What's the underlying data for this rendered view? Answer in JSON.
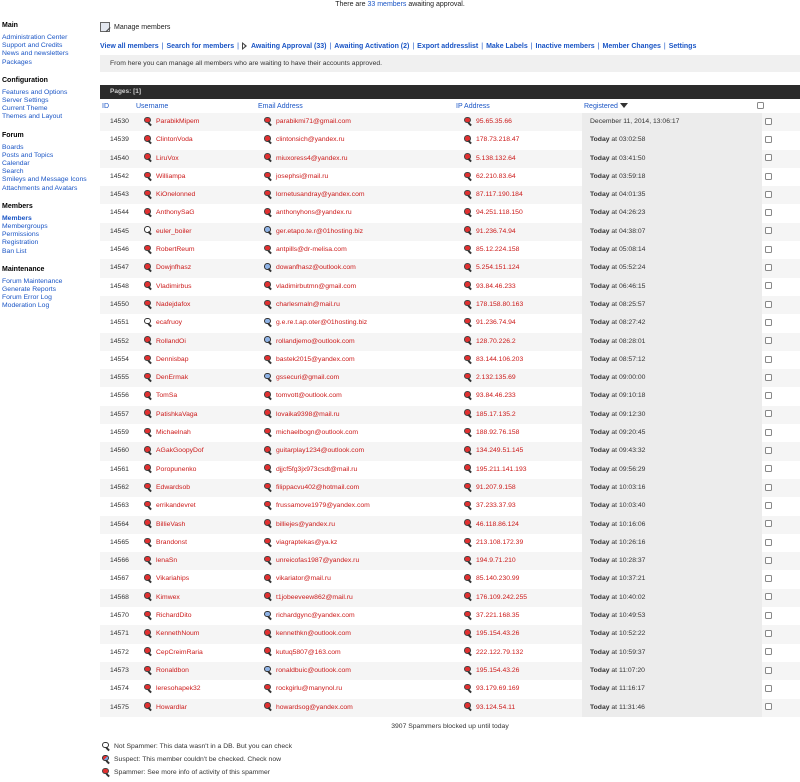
{
  "topbar": {
    "prefix": "There are",
    "link": "33 members",
    "suffix": "awaiting approval."
  },
  "sidebar": {
    "sections": [
      {
        "title": "Main",
        "items": [
          "Administration Center",
          "Support and Credits",
          "News and newsletters",
          "Packages"
        ]
      },
      {
        "title": "Configuration",
        "items": [
          "Features and Options",
          "Server Settings",
          "Current Theme",
          "Themes and Layout"
        ]
      },
      {
        "title": "Forum",
        "items": [
          "Boards",
          "Posts and Topics",
          "Calendar",
          "Search",
          "Smileys and Message Icons",
          "Attachments and Avatars"
        ]
      },
      {
        "title": "Members",
        "items": [
          "Members",
          "Membergroups",
          "Permissions",
          "Registration",
          "Ban List"
        ]
      },
      {
        "title": "Maintenance",
        "items": [
          "Forum Maintenance",
          "Generate Reports",
          "Forum Error Log",
          "Moderation Log"
        ]
      }
    ],
    "active_item": "Members"
  },
  "page_title": "Manage members",
  "tabs": [
    {
      "label": "View all members"
    },
    {
      "label": "Search for members"
    },
    {
      "label": "Awaiting Approval (33)"
    },
    {
      "label": "Awaiting Activation (2)"
    },
    {
      "label": "Export addresslist"
    },
    {
      "label": "Make Labels"
    },
    {
      "label": "Inactive members"
    },
    {
      "label": "Member Changes"
    },
    {
      "label": "Settings"
    }
  ],
  "description": "From here you can manage all members who are waiting to have their accounts approved.",
  "pages_label": "Pages: [1]",
  "columns": {
    "id": "ID",
    "username": "Username",
    "email": "Email Address",
    "ip": "IP Address",
    "registered": "Registered"
  },
  "members": [
    {
      "id": "14530",
      "username": "ParabikMipem",
      "email": "parabikmi71@gmail.com",
      "ip": "95.65.35.66",
      "reg_day": "December 11, 2014, 13:06:17",
      "reg_time": "",
      "ue": "red",
      "ee": "red",
      "ie": "red"
    },
    {
      "id": "14539",
      "username": "ClintonVoda",
      "email": "clintonsich@yandex.ru",
      "ip": "178.73.218.47",
      "reg_day": "Today",
      "reg_time": "at 03:02:58",
      "ue": "red",
      "ee": "red",
      "ie": "red"
    },
    {
      "id": "14540",
      "username": "LiruVox",
      "email": "miuxoress4@yandex.ru",
      "ip": "5.138.132.64",
      "reg_day": "Today",
      "reg_time": "at 03:41:50",
      "ue": "red",
      "ee": "red",
      "ie": "red"
    },
    {
      "id": "14542",
      "username": "Williampa",
      "email": "josephsi@mail.ru",
      "ip": "62.210.83.64",
      "reg_day": "Today",
      "reg_time": "at 03:59:18",
      "ue": "red",
      "ee": "red",
      "ie": "red"
    },
    {
      "id": "14543",
      "username": "KiOnelonned",
      "email": "lornetusandray@yandex.com",
      "ip": "87.117.190.184",
      "reg_day": "Today",
      "reg_time": "at 04:01:35",
      "ue": "red",
      "ee": "red",
      "ie": "red"
    },
    {
      "id": "14544",
      "username": "AnthonySaG",
      "email": "anthonyhons@yandex.ru",
      "ip": "94.251.118.150",
      "reg_day": "Today",
      "reg_time": "at 04:26:23",
      "ue": "red",
      "ee": "red",
      "ie": "red"
    },
    {
      "id": "14545",
      "username": "euler_boiler",
      "email": "ger.etapo.te.r@01hosting.biz",
      "ip": "91.236.74.94",
      "reg_day": "Today",
      "reg_time": "at 04:38:07",
      "ue": "white",
      "ee": "blue",
      "ie": "red"
    },
    {
      "id": "14546",
      "username": "RobertReum",
      "email": "antpills@dr-melisa.com",
      "ip": "85.12.224.158",
      "reg_day": "Today",
      "reg_time": "at 05:08:14",
      "ue": "red",
      "ee": "red",
      "ie": "red"
    },
    {
      "id": "14547",
      "username": "Dowjnfhasz",
      "email": "dowanfhasz@outlook.com",
      "ip": "5.254.151.124",
      "reg_day": "Today",
      "reg_time": "at 05:52:24",
      "ue": "red",
      "ee": "blue",
      "ie": "red"
    },
    {
      "id": "14548",
      "username": "Vladimirbus",
      "email": "vladimirbutmn@gmail.com",
      "ip": "93.84.46.233",
      "reg_day": "Today",
      "reg_time": "at 06:46:15",
      "ue": "red",
      "ee": "red",
      "ie": "red"
    },
    {
      "id": "14550",
      "username": "Nadejdafox",
      "email": "charlesmaln@mail.ru",
      "ip": "178.158.80.163",
      "reg_day": "Today",
      "reg_time": "at 08:25:57",
      "ue": "red",
      "ee": "red",
      "ie": "red"
    },
    {
      "id": "14551",
      "username": "ecafruoy",
      "email": "g.e.re.t.ap.oter@01hosting.biz",
      "ip": "91.236.74.94",
      "reg_day": "Today",
      "reg_time": "at 08:27:42",
      "ue": "white",
      "ee": "blue",
      "ie": "red"
    },
    {
      "id": "14552",
      "username": "RollandOi",
      "email": "rollandjemo@outlook.com",
      "ip": "128.70.226.2",
      "reg_day": "Today",
      "reg_time": "at 08:28:01",
      "ue": "red",
      "ee": "blue",
      "ie": "red"
    },
    {
      "id": "14554",
      "username": "Dennisbap",
      "email": "bastek2015@yandex.com",
      "ip": "83.144.106.203",
      "reg_day": "Today",
      "reg_time": "at 08:57:12",
      "ue": "red",
      "ee": "red",
      "ie": "red"
    },
    {
      "id": "14555",
      "username": "DenErmak",
      "email": "gssecuri@gmail.com",
      "ip": "2.132.135.69",
      "reg_day": "Today",
      "reg_time": "at 09:00:00",
      "ue": "red",
      "ee": "blue",
      "ie": "red"
    },
    {
      "id": "14556",
      "username": "TomSa",
      "email": "tomvott@outlook.com",
      "ip": "93.84.46.233",
      "reg_day": "Today",
      "reg_time": "at 09:10:18",
      "ue": "red",
      "ee": "red",
      "ie": "red"
    },
    {
      "id": "14557",
      "username": "PatishkaVaga",
      "email": "lovaika9398@mail.ru",
      "ip": "185.17.135.2",
      "reg_day": "Today",
      "reg_time": "at 09:12:30",
      "ue": "red",
      "ee": "red",
      "ie": "red"
    },
    {
      "id": "14559",
      "username": "Michaelnah",
      "email": "michaelbogn@outlook.com",
      "ip": "188.92.76.158",
      "reg_day": "Today",
      "reg_time": "at 09:20:45",
      "ue": "red",
      "ee": "red",
      "ie": "red"
    },
    {
      "id": "14560",
      "username": "AGakGoopyDof",
      "email": "guitarplay1234@outlook.com",
      "ip": "134.249.51.145",
      "reg_day": "Today",
      "reg_time": "at 09:43:32",
      "ue": "red",
      "ee": "red",
      "ie": "red"
    },
    {
      "id": "14561",
      "username": "Poropunenko",
      "email": "djjcf5fg3jx973csdt@mail.ru",
      "ip": "195.211.141.193",
      "reg_day": "Today",
      "reg_time": "at 09:56:29",
      "ue": "red",
      "ee": "red",
      "ie": "red"
    },
    {
      "id": "14562",
      "username": "Edwardsob",
      "email": "filippacvu402@hotmail.com",
      "ip": "91.207.9.158",
      "reg_day": "Today",
      "reg_time": "at 10:03:16",
      "ue": "red",
      "ee": "red",
      "ie": "red"
    },
    {
      "id": "14563",
      "username": "errikandevret",
      "email": "frussamove1979@yandex.com",
      "ip": "37.233.37.93",
      "reg_day": "Today",
      "reg_time": "at 10:03:40",
      "ue": "red",
      "ee": "red",
      "ie": "red"
    },
    {
      "id": "14564",
      "username": "BillieVash",
      "email": "billiejes@yandex.ru",
      "ip": "46.118.86.124",
      "reg_day": "Today",
      "reg_time": "at 10:16:06",
      "ue": "red",
      "ee": "red",
      "ie": "red"
    },
    {
      "id": "14565",
      "username": "Brandonst",
      "email": "viagraptekas@ya.kz",
      "ip": "213.108.172.39",
      "reg_day": "Today",
      "reg_time": "at 10:26:16",
      "ue": "red",
      "ee": "red",
      "ie": "red"
    },
    {
      "id": "14566",
      "username": "lenaSn",
      "email": "unreicofas1987@yandex.ru",
      "ip": "194.9.71.210",
      "reg_day": "Today",
      "reg_time": "at 10:28:37",
      "ue": "red",
      "ee": "red",
      "ie": "red"
    },
    {
      "id": "14567",
      "username": "Vikariahips",
      "email": "vikariator@mail.ru",
      "ip": "85.140.230.99",
      "reg_day": "Today",
      "reg_time": "at 10:37:21",
      "ue": "red",
      "ee": "red",
      "ie": "red"
    },
    {
      "id": "14568",
      "username": "Kimwex",
      "email": "t1jobeeveew862@mail.ru",
      "ip": "176.109.242.255",
      "reg_day": "Today",
      "reg_time": "at 10:40:02",
      "ue": "red",
      "ee": "red",
      "ie": "red"
    },
    {
      "id": "14570",
      "username": "RichardDito",
      "email": "richardgync@yandex.com",
      "ip": "37.221.168.35",
      "reg_day": "Today",
      "reg_time": "at 10:49:53",
      "ue": "red",
      "ee": "blue",
      "ie": "red"
    },
    {
      "id": "14571",
      "username": "KennethNoum",
      "email": "kennethkn@outlook.com",
      "ip": "195.154.43.26",
      "reg_day": "Today",
      "reg_time": "at 10:52:22",
      "ue": "red",
      "ee": "red",
      "ie": "red"
    },
    {
      "id": "14572",
      "username": "CepCreimRaria",
      "email": "kutuq5807@163.com",
      "ip": "222.122.79.132",
      "reg_day": "Today",
      "reg_time": "at 10:59:37",
      "ue": "red",
      "ee": "red",
      "ie": "red"
    },
    {
      "id": "14573",
      "username": "Ronaldbon",
      "email": "ronaldbuic@outlook.com",
      "ip": "195.154.43.26",
      "reg_day": "Today",
      "reg_time": "at 11:07:20",
      "ue": "red",
      "ee": "blue",
      "ie": "red"
    },
    {
      "id": "14574",
      "username": "leresohapek32",
      "email": "rockgirlu@manynol.ru",
      "ip": "93.179.69.169",
      "reg_day": "Today",
      "reg_time": "at 11:16:17",
      "ue": "red",
      "ee": "red",
      "ie": "red"
    },
    {
      "id": "14575",
      "username": "Howardlar",
      "email": "howardsog@yandex.com",
      "ip": "93.124.54.11",
      "reg_day": "Today",
      "reg_time": "at 11:31:46",
      "ue": "red",
      "ee": "red",
      "ie": "red"
    }
  ],
  "blocked_text": "3907 Spammers blocked up until today",
  "legend": [
    {
      "icon": "white",
      "text": "Not Spammer: This data wasn't in a DB. But you can check"
    },
    {
      "icon": "half",
      "text": "Suspect: This member couldn't be checked. Check now"
    },
    {
      "icon": "red",
      "text": "Spammer: See more info of activity of this spammer"
    }
  ],
  "colors": {
    "link": "#1a55c5",
    "spam_link": "#cc1a1a",
    "header_bar": "#2b2b2b"
  }
}
